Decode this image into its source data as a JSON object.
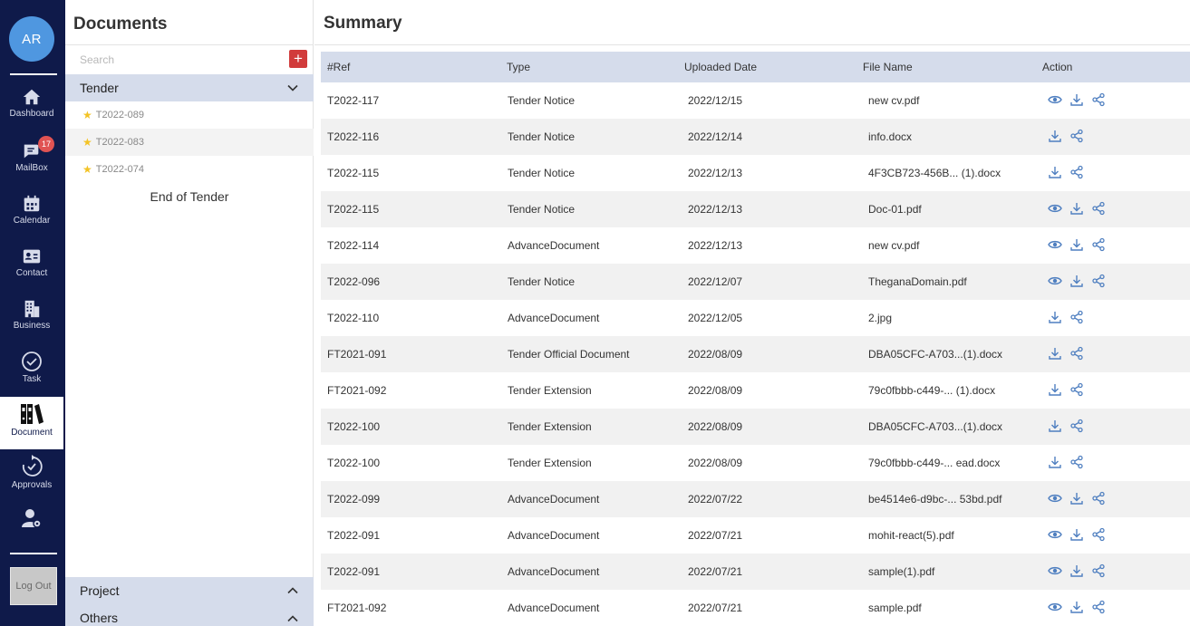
{
  "user": {
    "initials": "AR"
  },
  "nav": {
    "dashboard": "Dashboard",
    "mailbox": "MailBox",
    "mailbox_badge": "17",
    "calendar": "Calendar",
    "contact": "Contact",
    "business": "Business",
    "task": "Task",
    "document": "Document",
    "approvals": "Approvals",
    "logout": "Log Out"
  },
  "documents": {
    "title": "Documents",
    "search_placeholder": "Search",
    "add_label": "+",
    "tender_label": "Tender",
    "tender_items": [
      "T2022-089",
      "T2022-083",
      "T2022-074"
    ],
    "end_text": "End of Tender",
    "project_label": "Project",
    "others_label": "Others"
  },
  "summary": {
    "title": "Summary",
    "columns": [
      "#Ref",
      "Type",
      "Uploaded Date",
      "File Name",
      "Action"
    ],
    "rows": [
      {
        "ref": "T2022-117",
        "type": "Tender Notice",
        "date": "2022/12/15",
        "file": "new cv.pdf",
        "view": true
      },
      {
        "ref": "T2022-116",
        "type": "Tender Notice",
        "date": "2022/12/14",
        "file": "info.docx",
        "view": false
      },
      {
        "ref": "T2022-115",
        "type": "Tender Notice",
        "date": "2022/12/13",
        "file": "4F3CB723-456B... (1).docx",
        "view": false
      },
      {
        "ref": "T2022-115",
        "type": "Tender Notice",
        "date": "2022/12/13",
        "file": "Doc-01.pdf",
        "view": true
      },
      {
        "ref": "T2022-114",
        "type": "AdvanceDocument",
        "date": "2022/12/13",
        "file": "new cv.pdf",
        "view": true
      },
      {
        "ref": "T2022-096",
        "type": "Tender Notice",
        "date": "2022/12/07",
        "file": "TheganaDomain.pdf",
        "view": true
      },
      {
        "ref": "T2022-110",
        "type": "AdvanceDocument",
        "date": "2022/12/05",
        "file": "2.jpg",
        "view": false
      },
      {
        "ref": "FT2021-091",
        "type": "Tender Official Document",
        "date": "2022/08/09",
        "file": "DBA05CFC-A703...(1).docx",
        "view": false
      },
      {
        "ref": "FT2021-092",
        "type": "Tender Extension",
        "date": "2022/08/09",
        "file": "79c0fbbb-c449-... (1).docx",
        "view": false
      },
      {
        "ref": "T2022-100",
        "type": "Tender Extension",
        "date": "2022/08/09",
        "file": "DBA05CFC-A703...(1).docx",
        "view": false
      },
      {
        "ref": "T2022-100",
        "type": "Tender Extension",
        "date": "2022/08/09",
        "file": "79c0fbbb-c449-... ead.docx",
        "view": false
      },
      {
        "ref": "T2022-099",
        "type": "AdvanceDocument",
        "date": "2022/07/22",
        "file": "be4514e6-d9bc-... 53bd.pdf",
        "view": true
      },
      {
        "ref": "T2022-091",
        "type": "AdvanceDocument",
        "date": "2022/07/21",
        "file": "mohit-react(5).pdf",
        "view": true
      },
      {
        "ref": "T2022-091",
        "type": "AdvanceDocument",
        "date": "2022/07/21",
        "file": "sample(1).pdf",
        "view": true
      },
      {
        "ref": "FT2021-092",
        "type": "AdvanceDocument",
        "date": "2022/07/21",
        "file": "sample.pdf",
        "view": true
      }
    ]
  },
  "colors": {
    "rail": "#0f1a4a",
    "header_band": "#d5dceb",
    "accent": "#4f7fc0",
    "badge": "#e05353",
    "add": "#d13b3b"
  }
}
